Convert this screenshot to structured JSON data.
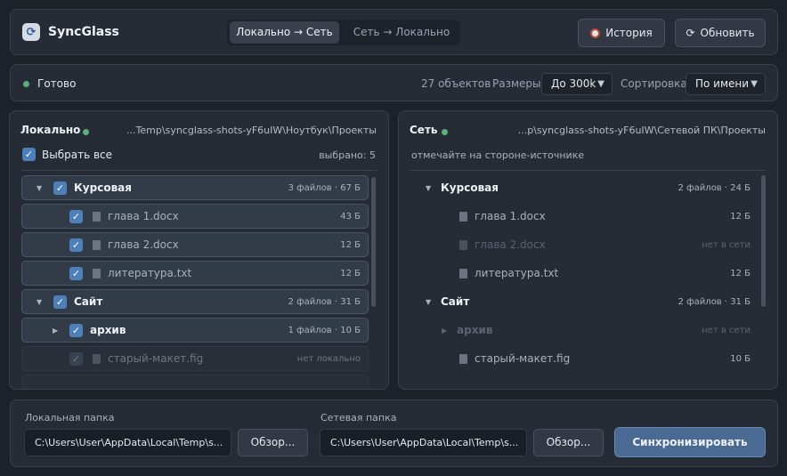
{
  "app": {
    "title": "SyncGlass"
  },
  "header": {
    "modes": [
      {
        "label": "Локально → Сеть",
        "active": true
      },
      {
        "label": "Сеть → Локально",
        "active": false
      }
    ],
    "history_label": "История",
    "refresh_label": "Обновить"
  },
  "status": {
    "text": "Готово",
    "count": "27 объектов",
    "sizes_label": "Размеры",
    "sizes_value": "До 300k",
    "sort_label": "Сортировка",
    "sort_value": "По имени"
  },
  "local": {
    "title": "Локально",
    "path": "...Temp\\syncglass-shots-yF6uIW\\Ноутбук\\Проекты",
    "select_all": "Выбрать все",
    "selected": "выбрано: 5",
    "rows": [
      {
        "name": "Курсовая",
        "meta": "3 файлов · 67 Б"
      },
      {
        "name": "глава 1.docx",
        "meta": "43 Б"
      },
      {
        "name": "глава 2.docx",
        "meta": "12 Б"
      },
      {
        "name": "литература.txt",
        "meta": "12 Б"
      },
      {
        "name": "Сайт",
        "meta": "2 файлов · 31 Б"
      },
      {
        "name": "архив",
        "meta": "1 файлов · 10 Б"
      },
      {
        "name": "старый-макет.fig",
        "meta": "нет локально"
      }
    ]
  },
  "remote": {
    "title": "Сеть",
    "path": "...p\\syncglass-shots-yF6uIW\\Сетевой ПК\\Проекты",
    "hint": "отмечайте на стороне-источнике",
    "rows": [
      {
        "name": "Курсовая",
        "meta": "2 файлов · 24 Б"
      },
      {
        "name": "глава 1.docx",
        "meta": "12 Б"
      },
      {
        "name": "глава 2.docx",
        "meta": "нет в сети"
      },
      {
        "name": "литература.txt",
        "meta": "12 Б"
      },
      {
        "name": "Сайт",
        "meta": "2 файлов · 31 Б"
      },
      {
        "name": "архив",
        "meta": "нет в сети"
      },
      {
        "name": "старый-макет.fig",
        "meta": "10 Б"
      }
    ]
  },
  "footer": {
    "local_label": "Локальная папка",
    "local_path": "C:\\Users\\User\\AppData\\Local\\Temp\\s...",
    "remote_label": "Сетевая папка",
    "remote_path": "C:\\Users\\User\\AppData\\Local\\Temp\\s...",
    "browse_label": "Обзор...",
    "sync_label": "Синхронизировать"
  },
  "colors": {
    "accent": "#4f7fb8",
    "ok": "#5db07b",
    "sync_button": "#4a6a93"
  }
}
